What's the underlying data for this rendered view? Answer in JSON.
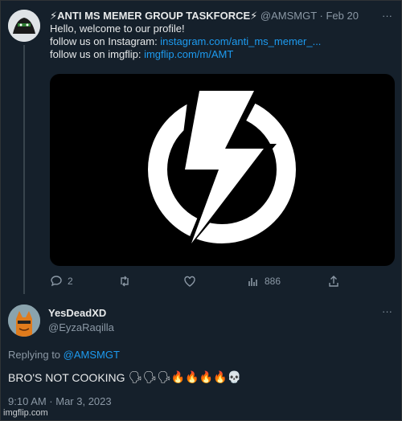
{
  "tweet1": {
    "name": "⚡ANTI MS MEMER GROUP TASKFORCE⚡",
    "handle": "@AMSMGT · Feb 20",
    "more": "···",
    "line1": "Hello, welcome to our profile!",
    "line2_prefix": "follow us on Instagram: ",
    "line2_link": "instagram.com/anti_ms_memer_...",
    "line3_prefix": "follow us on imgflip: ",
    "line3_link": "imgflip.com/m/AMT",
    "media_icon": "lightning-circle-logo",
    "stats": {
      "replies": "2",
      "retweets": "",
      "likes": "",
      "views": "886"
    }
  },
  "tweet2": {
    "name": "YesDeadXD",
    "handle": "@EyzaRaqilla",
    "more": "···",
    "replying_prefix": "Replying to ",
    "replying_handle": "@AMSMGT",
    "text": "BRO'S NOT COOKING",
    "emojis": "🗣🗣🗣🔥🔥🔥🔥💀",
    "timestamp": "9:10 AM · Mar 3, 2023"
  },
  "watermark": "imgflip.com",
  "colors": {
    "background": "#15202b",
    "text": "#e7e9ea",
    "secondary": "#8b98a5",
    "link": "#1d9bf0"
  }
}
